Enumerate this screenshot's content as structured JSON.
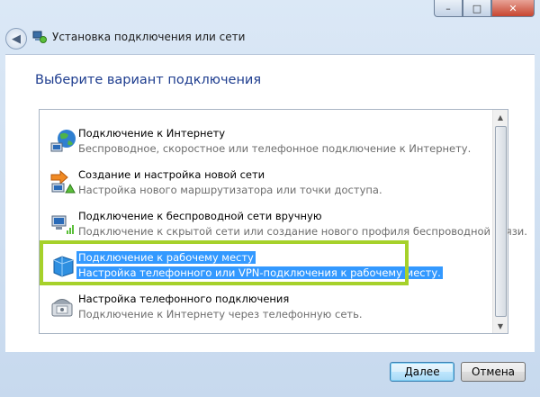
{
  "window": {
    "title": "Установка подключения или сети",
    "controls": {
      "minimize": "–",
      "maximize": "□",
      "close": "✕"
    },
    "back_glyph": "◀"
  },
  "page": {
    "heading": "Выберите вариант подключения"
  },
  "options": [
    {
      "title": "Подключение к Интернету",
      "description": "Беспроводное, скоростное или телефонное подключение к Интернету.",
      "icon": "globe-network-icon",
      "selected": false
    },
    {
      "title": "Создание и настройка новой сети",
      "description": "Настройка нового маршрутизатора или точки доступа.",
      "icon": "new-network-icon",
      "selected": false
    },
    {
      "title": "Подключение к беспроводной сети вручную",
      "description": "Подключение к скрытой сети или создание нового профиля беспроводной связи.",
      "icon": "wireless-network-icon",
      "selected": false
    },
    {
      "title": "Подключение к рабочему месту",
      "description": "Настройка телефонного или VPN-подключения к рабочему месту.",
      "icon": "workplace-vpn-icon",
      "selected": true
    },
    {
      "title": "Настройка телефонного подключения",
      "description": "Подключение к Интернету через телефонную сеть.",
      "icon": "dialup-phone-icon",
      "selected": false
    }
  ],
  "buttons": {
    "next": "Далее",
    "cancel": "Отмена"
  },
  "colors": {
    "selection": "#3399ff",
    "highlight_frame": "#a6d12a",
    "heading": "#1e3d8f"
  }
}
